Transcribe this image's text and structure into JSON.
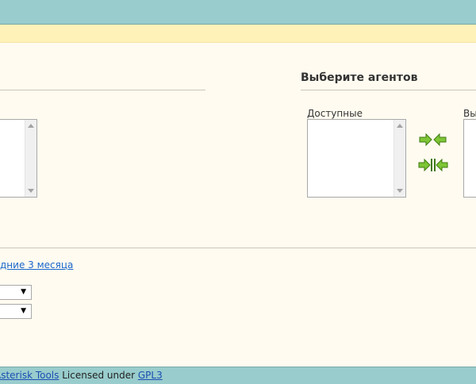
{
  "section": {
    "agents_title": "Выберите агентов"
  },
  "agents": {
    "available_label": "Доступные",
    "selected_label": "Вы"
  },
  "links": {
    "last_3_months": "дние 3 месяца"
  },
  "selects": {
    "first_value": "",
    "second_value": ""
  },
  "footer": {
    "product_link": "Asterisk Tools",
    "licensed_text": " Licensed under ",
    "license_link": "GPL3"
  },
  "icons": {
    "move_one": "arrows-left-right-icon",
    "move_all": "arrows-all-icon"
  },
  "colors": {
    "header": "#99cccc",
    "notice": "#fff2b8",
    "background": "#fffbf0",
    "link": "#1a66cc"
  }
}
